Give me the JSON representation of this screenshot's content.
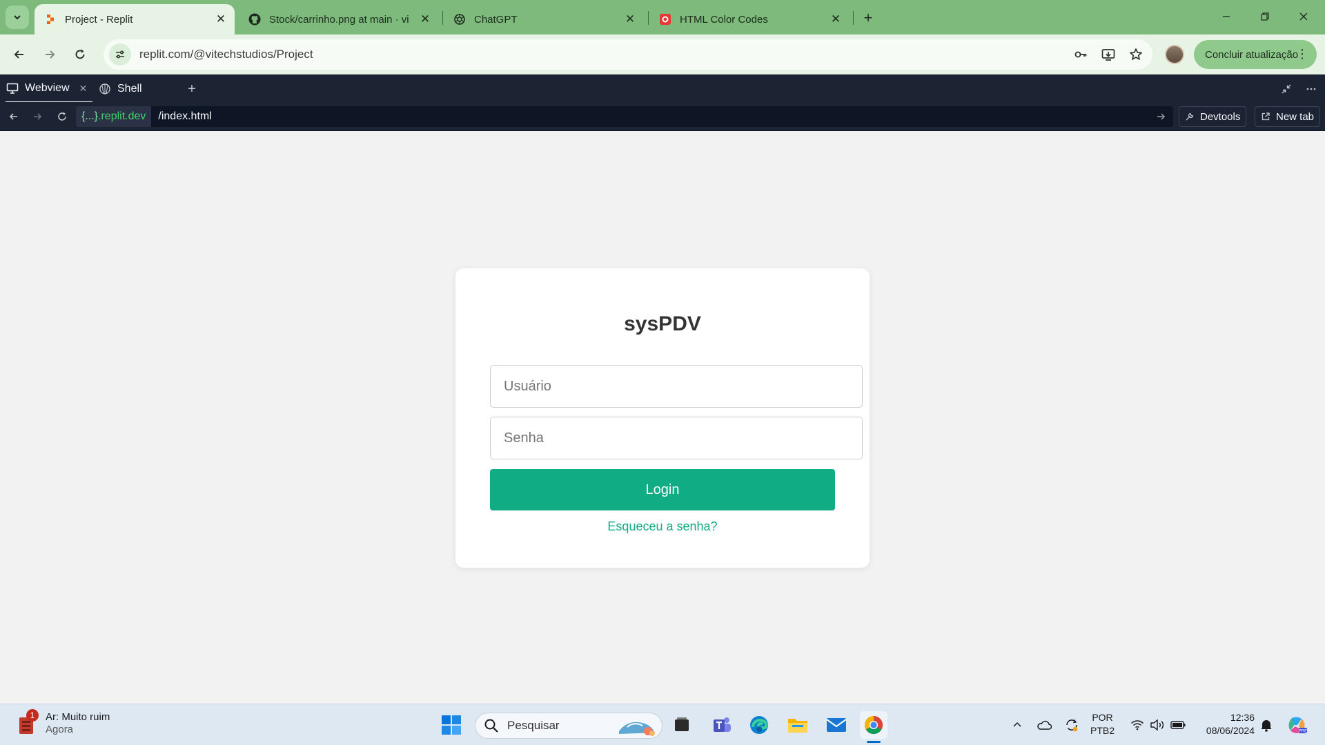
{
  "browser": {
    "tabs": [
      {
        "title": "Project - Replit",
        "active": true
      },
      {
        "title": "Stock/carrinho.png at main · vi"
      },
      {
        "title": "ChatGPT"
      },
      {
        "title": "HTML Color Codes"
      }
    ],
    "tab_close_glyph": "✕",
    "new_tab_glyph": "+",
    "address": "replit.com/@vitechstudios/Project",
    "update_label": "Concluir atualização",
    "update_menu_glyph": "⋮"
  },
  "replit": {
    "tabs": [
      {
        "label": "Webview",
        "icon": "monitor-icon"
      },
      {
        "label": "Shell",
        "icon": "shell-icon"
      }
    ],
    "domain_hash": "{...}",
    "domain_suffix": ".replit.dev",
    "path": "/index.html",
    "devtools_label": "Devtools",
    "newtab_label": "New tab"
  },
  "login": {
    "title": "sysPDV",
    "username_placeholder": "Usuário",
    "password_placeholder": "Senha",
    "login_label": "Login",
    "forgot_label": "Esqueceu a senha?",
    "accent_color": "#10ac84"
  },
  "taskbar": {
    "weather_title": "Ar: Muito ruim",
    "weather_subtitle": "Agora",
    "weather_badge": "1",
    "search_placeholder": "Pesquisar",
    "lang_line1": "POR",
    "lang_line2": "PTB2",
    "time": "12:36",
    "date": "08/06/2024"
  }
}
